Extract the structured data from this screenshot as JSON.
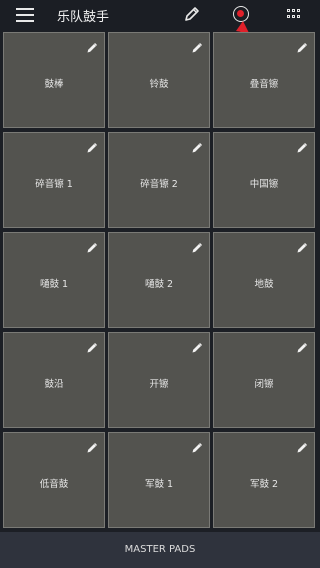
{
  "header": {
    "title": "乐队鼓手",
    "menu_icon": "hamburger-menu-icon",
    "edit_icon": "pencil-icon",
    "record_icon": "record-icon",
    "grid_icon": "grid-icon",
    "record_color": "#e0202a",
    "annotation_arrow_color": "#e0202a"
  },
  "pads": [
    {
      "label": "鼓棒"
    },
    {
      "label": "铃鼓"
    },
    {
      "label": "叠音镲"
    },
    {
      "label": "碎音镲 1"
    },
    {
      "label": "碎音镲 2"
    },
    {
      "label": "中国镲"
    },
    {
      "label": "嗵鼓 1"
    },
    {
      "label": "嗵鼓 2"
    },
    {
      "label": "地鼓"
    },
    {
      "label": "鼓沿"
    },
    {
      "label": "开镲"
    },
    {
      "label": "闭镲"
    },
    {
      "label": "低音鼓"
    },
    {
      "label": "军鼓 1"
    },
    {
      "label": "军鼓 2"
    }
  ],
  "footer": {
    "label": "MASTER PADS"
  },
  "colors": {
    "background": "#1c1f25",
    "pad_fill": "#53534f",
    "pad_border": "#7a7a76",
    "footer_bg": "#2f333d"
  }
}
